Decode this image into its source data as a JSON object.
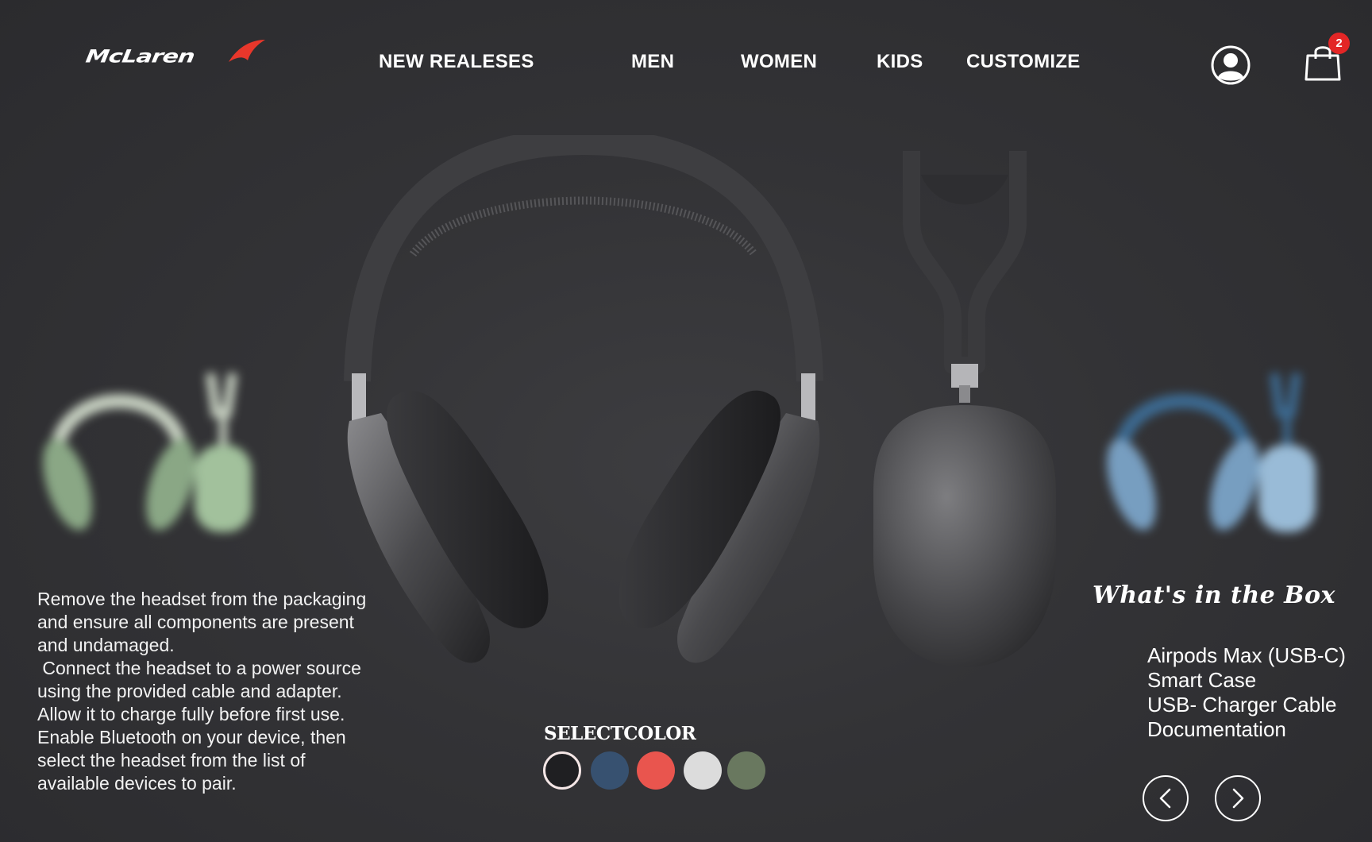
{
  "brand": {
    "name": "McLaren",
    "accent_color": "#e8372b"
  },
  "nav": {
    "items": [
      {
        "label": "NEW REALESES"
      },
      {
        "label": "MEN"
      },
      {
        "label": "WOMEN"
      },
      {
        "label": "KIDS"
      },
      {
        "label": "CUSTOMIZE"
      }
    ]
  },
  "header": {
    "account_icon": "user-circle-icon",
    "cart_icon": "shopping-bag-icon",
    "cart_count": "2"
  },
  "instructions": {
    "lines": [
      "Remove the headset from the packaging",
      "and ensure all components are present",
      "and undamaged.",
      " Connect the headset to a power source",
      "using the provided cable and adapter.",
      "Allow it to charge fully before first use.",
      "Enable Bluetooth on your device, then",
      "select the headset from the list of",
      "available devices to pair."
    ]
  },
  "box": {
    "title": "What's in the Box",
    "items": [
      "Airpods Max (USB-C)",
      "Smart Case",
      "USB- Charger Cable",
      "Documentation"
    ]
  },
  "color_selector": {
    "label": "SELECTCOLOR",
    "selected_index": 0,
    "colors": [
      "#1f1f22",
      "#375170",
      "#e9554e",
      "#dcdcdc",
      "#69785f"
    ]
  },
  "carousel": {
    "prev_icon": "chevron-left-icon",
    "next_icon": "chevron-right-icon"
  },
  "products": {
    "main_color": "space-gray",
    "left_preview_color": "#a8c9a2",
    "right_preview_color": "#8fb3d4"
  }
}
